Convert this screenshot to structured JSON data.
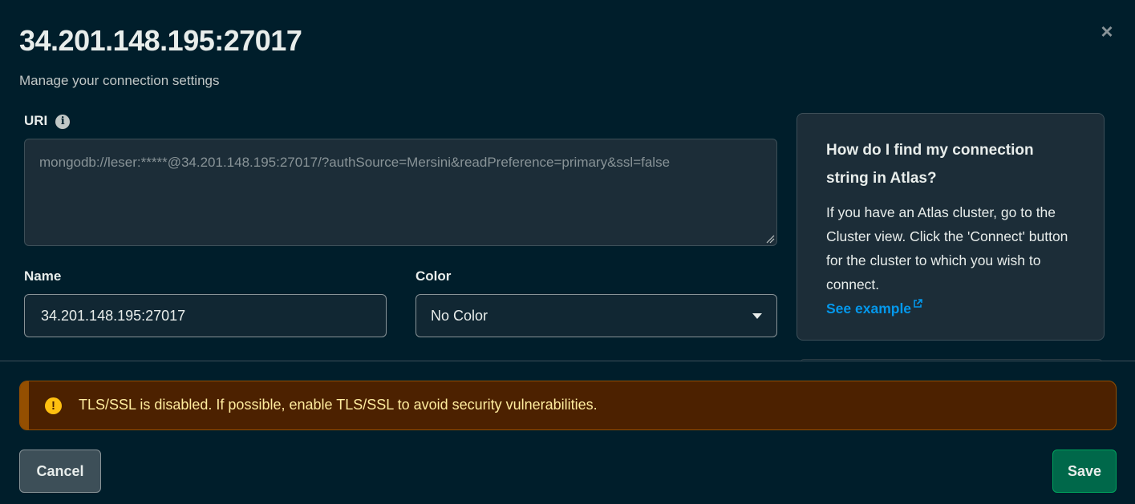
{
  "modal": {
    "title": "34.201.148.195:27017",
    "subtitle": "Manage your connection settings",
    "close_icon": "close-icon"
  },
  "uri": {
    "label": "URI",
    "info_icon": "info-icon",
    "value": "mongodb://leser:*****@34.201.148.195:27017/?authSource=Mersini&readPreference=primary&ssl=false"
  },
  "name_field": {
    "label": "Name",
    "value": "34.201.148.195:27017"
  },
  "color_field": {
    "label": "Color",
    "selected": "No Color"
  },
  "help": {
    "title": "How do I find my connection string in Atlas?",
    "body": "If you have an Atlas cluster, go to the Cluster view. Click the 'Connect' button for the cluster to which you wish to connect.",
    "link": "See example",
    "link_icon": "external-link-icon"
  },
  "banner": {
    "icon": "warning-icon",
    "text": "TLS/SSL is disabled. If possible, enable TLS/SSL to avoid security vulnerabilities."
  },
  "footer": {
    "cancel_label": "Cancel",
    "save_label": "Save"
  },
  "colors": {
    "background": "#001e2b",
    "link": "#0498ec",
    "warning_bg": "#4c2100",
    "warning_text": "#ffec9e",
    "save_bg": "#00684a"
  }
}
